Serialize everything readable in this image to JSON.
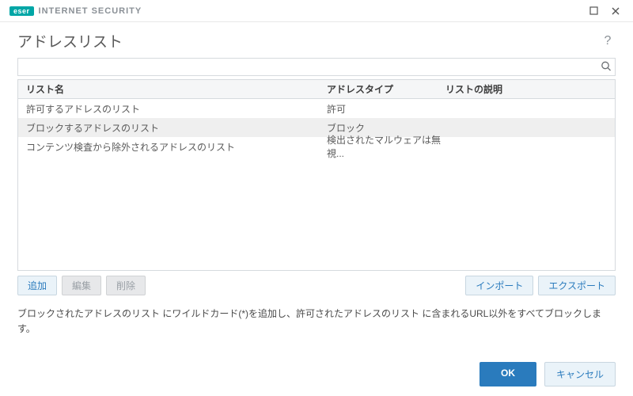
{
  "brand": {
    "badge": "eser",
    "name": "INTERNET SECURITY"
  },
  "header": {
    "title": "アドレスリスト"
  },
  "search": {
    "value": ""
  },
  "table": {
    "headers": {
      "name": "リスト名",
      "type": "アドレスタイプ",
      "desc": "リストの説明"
    },
    "rows": [
      {
        "name": "許可するアドレスのリスト",
        "type": "許可",
        "desc": "",
        "selected": false
      },
      {
        "name": "ブロックするアドレスのリスト",
        "type": "ブロック",
        "desc": "",
        "selected": true
      },
      {
        "name": "コンテンツ検査から除外されるアドレスのリスト",
        "type": "検出されたマルウェアは無視...",
        "desc": "",
        "selected": false
      }
    ]
  },
  "toolbar": {
    "add": "追加",
    "edit": "編集",
    "remove": "削除",
    "import": "インポート",
    "export": "エクスポート"
  },
  "description": "ブロックされたアドレスのリスト にワイルドカード(*)を追加し、許可されたアドレスのリスト に含まれるURL以外をすべてブロックします。",
  "footer": {
    "ok": "OK",
    "cancel": "キャンセル"
  }
}
